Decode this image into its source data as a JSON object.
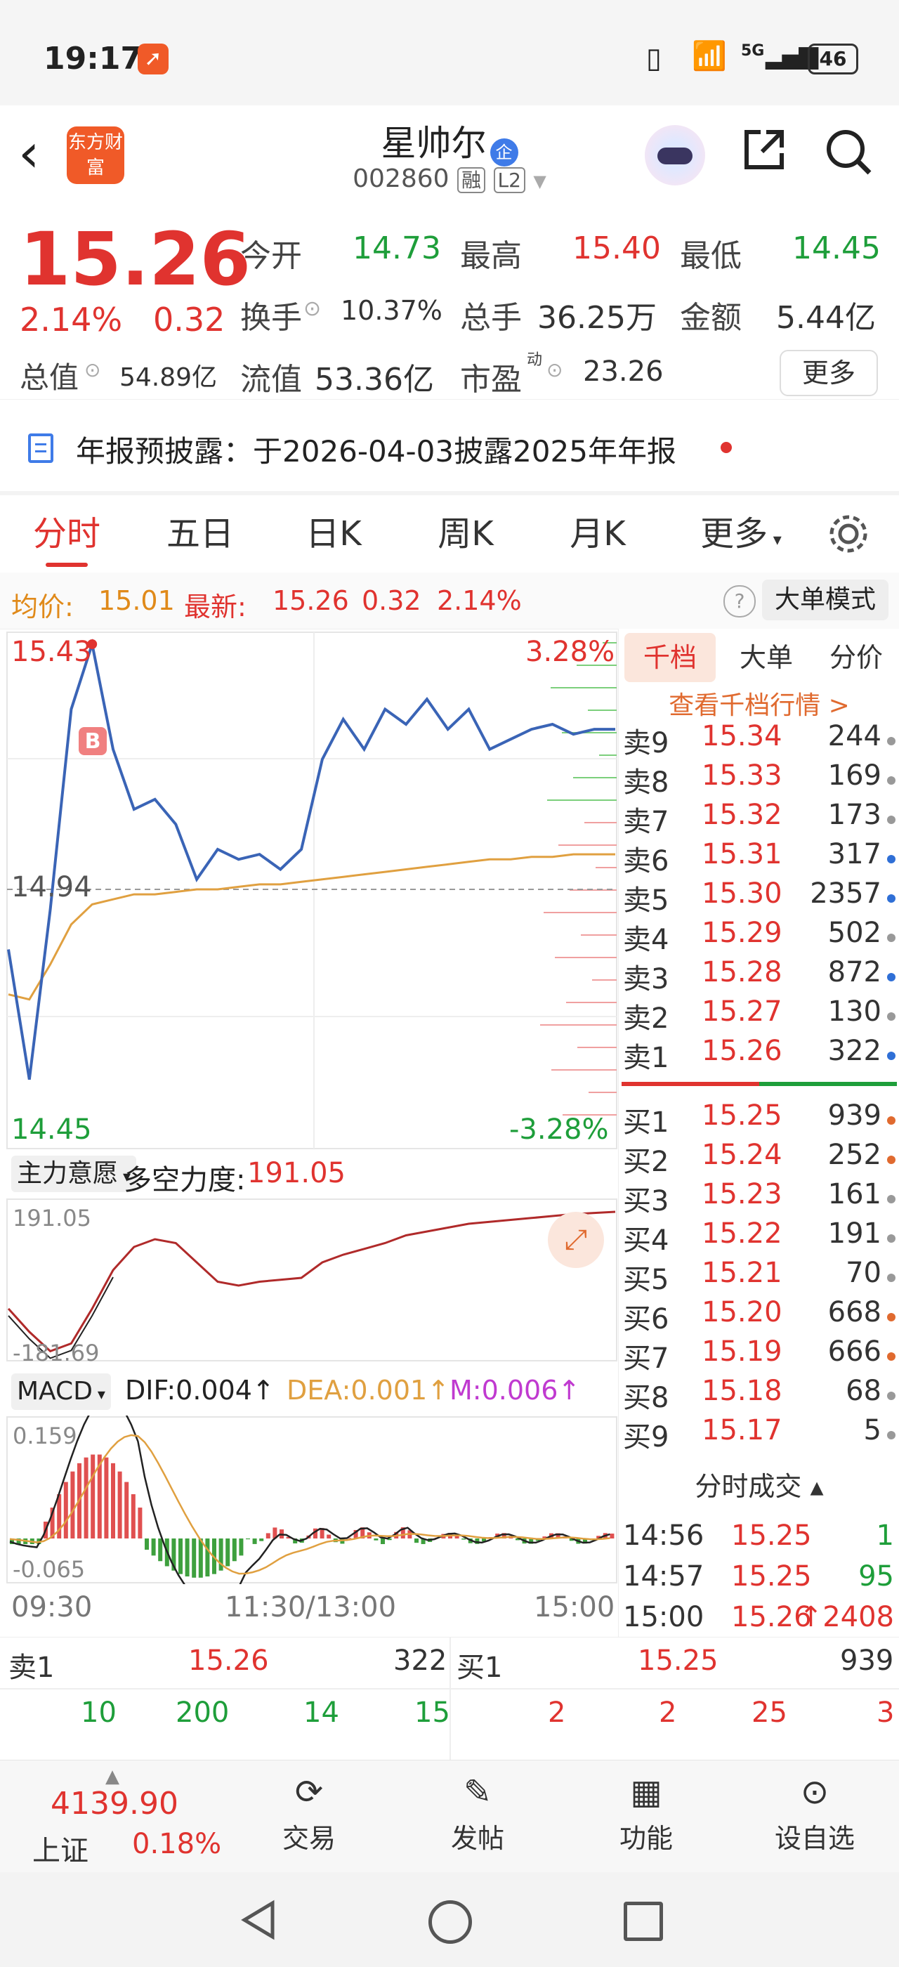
{
  "status_bar": {
    "time": "19:17",
    "battery": "46",
    "network": "5G"
  },
  "header": {
    "logo_text": "东方财富",
    "stock_name": "星帅尔",
    "badge": "企",
    "code": "002860",
    "tag1": "融",
    "tag2": "L2"
  },
  "quote": {
    "price": "15.26",
    "change_pct": "2.14%",
    "change": "0.32",
    "open_label": "今开",
    "open": "14.73",
    "high_label": "最高",
    "high": "15.40",
    "low_label": "最低",
    "low": "14.45",
    "turnover_label": "换手",
    "turnover": "10.37%",
    "volume_label": "总手",
    "volume": "36.25万",
    "amount_label": "金额",
    "amount": "5.44亿",
    "mktcap_label": "总值",
    "mktcap": "54.89亿",
    "float_label": "流值",
    "float": "53.36亿",
    "pe_label": "市盈",
    "pe_sup": "动",
    "pe": "23.26",
    "more_button": "更多"
  },
  "notice": {
    "text": "年报预披露：于2026-04-03披露2025年年报"
  },
  "tabs": [
    "分时",
    "五日",
    "日K",
    "周K",
    "月K",
    "更多"
  ],
  "infobar": {
    "avg_label": "均价:",
    "avg": "15.01",
    "latest_label": "最新:",
    "latest": "15.26",
    "latest_chg": "0.32",
    "latest_pct": "2.14%",
    "help": "?",
    "big_order_button": "大单模式"
  },
  "chart_data": {
    "type": "line",
    "title": "",
    "y_top_label": "15.43",
    "y_mid_label": "14.94",
    "y_bottom_label": "14.45",
    "pct_top": "3.28%",
    "pct_bottom": "-3.28%",
    "x_labels": [
      "09:30",
      "11:30/13:00",
      "15:00"
    ],
    "ylim": [
      14.45,
      15.43
    ],
    "prev_close": 14.94,
    "series": [
      {
        "values": [
          14.82,
          14.56,
          14.9,
          15.3,
          15.43,
          15.22,
          15.1,
          15.12,
          15.07,
          14.96,
          15.02,
          15.0,
          15.01,
          14.98,
          15.02,
          15.2,
          15.28,
          15.22,
          15.3,
          15.27,
          15.32,
          15.26,
          15.3,
          15.22,
          15.24,
          15.26,
          15.27,
          15.25,
          15.26,
          15.26
        ]
      },
      {
        "values": [
          14.73,
          14.72,
          14.79,
          14.87,
          14.91,
          14.92,
          14.93,
          14.93,
          14.935,
          14.94,
          14.94,
          14.945,
          14.95,
          14.95,
          14.955,
          14.96,
          14.965,
          14.97,
          14.975,
          14.98,
          14.985,
          14.99,
          14.995,
          15.0,
          15.0,
          15.005,
          15.005,
          15.01,
          15.01,
          15.01
        ]
      }
    ]
  },
  "indicator1": {
    "name": "主力意愿",
    "label": "多空力度:",
    "value": "191.05",
    "top": "191.05",
    "bottom": "-181.69"
  },
  "macd": {
    "name": "MACD",
    "dif": "DIF:0.004",
    "dea": "DEA:0.001",
    "m": "M:0.006",
    "top": "0.159",
    "bottom": "-0.065"
  },
  "order_book": {
    "tabs": [
      "千档",
      "大单",
      "分价"
    ],
    "link": "查看千档行情 >",
    "asks": [
      {
        "label": "卖9",
        "price": "15.34",
        "vol": "244",
        "dot": "#999999"
      },
      {
        "label": "卖8",
        "price": "15.33",
        "vol": "169",
        "dot": "#999999"
      },
      {
        "label": "卖7",
        "price": "15.32",
        "vol": "173",
        "dot": "#999999"
      },
      {
        "label": "卖6",
        "price": "15.31",
        "vol": "317",
        "dot": "#2f6fd6"
      },
      {
        "label": "卖5",
        "price": "15.30",
        "vol": "2357",
        "dot": "#2f6fd6"
      },
      {
        "label": "卖4",
        "price": "15.29",
        "vol": "502",
        "dot": "#999999"
      },
      {
        "label": "卖3",
        "price": "15.28",
        "vol": "872",
        "dot": "#2f6fd6"
      },
      {
        "label": "卖2",
        "price": "15.27",
        "vol": "130",
        "dot": "#999999"
      },
      {
        "label": "卖1",
        "price": "15.26",
        "vol": "322",
        "dot": "#2f6fd6"
      }
    ],
    "bids": [
      {
        "label": "买1",
        "price": "15.25",
        "vol": "939",
        "dot": "#e06a2f"
      },
      {
        "label": "买2",
        "price": "15.24",
        "vol": "252",
        "dot": "#e06a2f"
      },
      {
        "label": "买3",
        "price": "15.23",
        "vol": "161",
        "dot": "#999999"
      },
      {
        "label": "买4",
        "price": "15.22",
        "vol": "191",
        "dot": "#999999"
      },
      {
        "label": "买5",
        "price": "15.21",
        "vol": "70",
        "dot": "#999999"
      },
      {
        "label": "买6",
        "price": "15.20",
        "vol": "668",
        "dot": "#e06a2f"
      },
      {
        "label": "买7",
        "price": "15.19",
        "vol": "666",
        "dot": "#e06a2f"
      },
      {
        "label": "买8",
        "price": "15.18",
        "vol": "68",
        "dot": "#999999"
      },
      {
        "label": "买9",
        "price": "15.17",
        "vol": "5",
        "dot": "#999999"
      }
    ],
    "ticks_title": "分时成交",
    "ticks": [
      {
        "time": "14:56",
        "price": "15.25",
        "vol": "1"
      },
      {
        "time": "14:57",
        "price": "15.25",
        "vol": "95"
      },
      {
        "time": "15:00",
        "price": "15.26",
        "vol": "2408"
      }
    ]
  },
  "bottom_table": {
    "left_label": "卖1",
    "left_price": "15.26",
    "left_vol": "322",
    "right_label": "买1",
    "right_price": "15.25",
    "right_vol": "939",
    "left_row1": [
      "10",
      "200",
      "14",
      "15"
    ],
    "right_row1": [
      "2",
      "2",
      "25",
      "3"
    ]
  },
  "bottom_bar": {
    "index_value": "4139.90",
    "index_name": "上证",
    "index_pct": "0.18%",
    "items": [
      "交易",
      "发帖",
      "功能",
      "设自选"
    ]
  }
}
